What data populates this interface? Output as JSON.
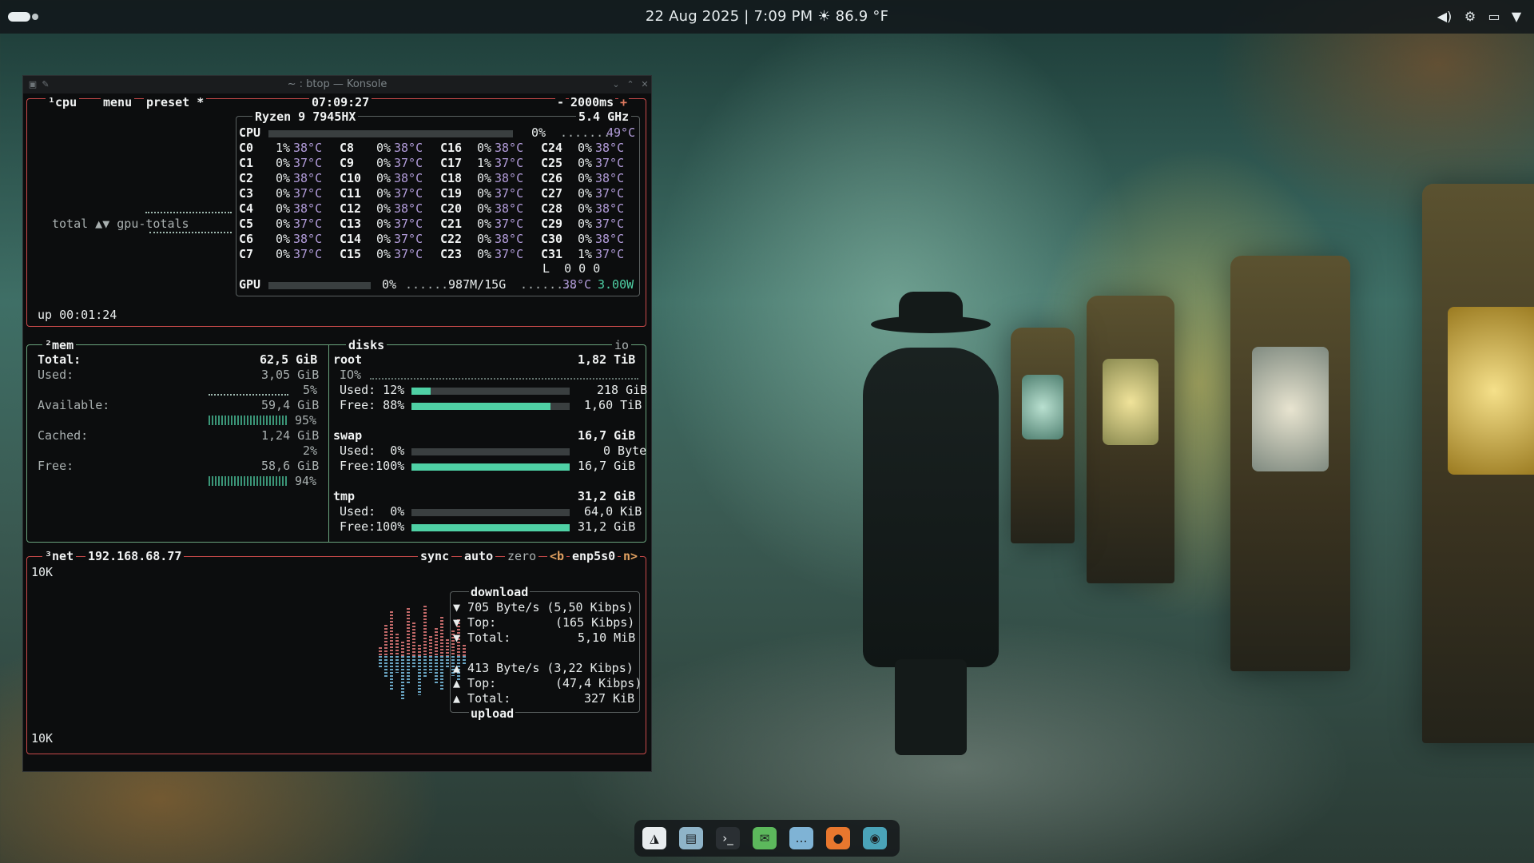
{
  "topbar": {
    "datetime": "22 Aug 2025 | 7:09 PM",
    "weather_glyph": "☀",
    "temp": "86.9 °F"
  },
  "window": {
    "title": "~ : btop — Konsole"
  },
  "cpu": {
    "tab": "¹cpu",
    "menu": "menu",
    "preset": "preset *",
    "clock": "07:09:27",
    "interval_minus": "-",
    "interval": "2000ms",
    "interval_plus": "+",
    "model": "Ryzen 9 7945HX",
    "freq": "5.4 GHz",
    "total_label": "CPU",
    "total_pct": "0%",
    "total_temp": "49°C",
    "cpu_fill": 1.0,
    "graph_label": "total ▲▼ gpu-totals",
    "uptime": "up 00:01:24",
    "load": "L  0 0 0",
    "cores": [
      [
        "C0",
        "1%",
        "38°C"
      ],
      [
        "C1",
        "0%",
        "37°C"
      ],
      [
        "C2",
        "0%",
        "38°C"
      ],
      [
        "C3",
        "0%",
        "37°C"
      ],
      [
        "C4",
        "0%",
        "38°C"
      ],
      [
        "C5",
        "0%",
        "37°C"
      ],
      [
        "C6",
        "0%",
        "38°C"
      ],
      [
        "C7",
        "0%",
        "37°C"
      ],
      [
        "C8",
        "0%",
        "38°C"
      ],
      [
        "C9",
        "0%",
        "37°C"
      ],
      [
        "C10",
        "0%",
        "38°C"
      ],
      [
        "C11",
        "0%",
        "37°C"
      ],
      [
        "C12",
        "0%",
        "38°C"
      ],
      [
        "C13",
        "0%",
        "37°C"
      ],
      [
        "C14",
        "0%",
        "37°C"
      ],
      [
        "C15",
        "0%",
        "37°C"
      ],
      [
        "C16",
        "0%",
        "38°C"
      ],
      [
        "C17",
        "1%",
        "37°C"
      ],
      [
        "C18",
        "0%",
        "38°C"
      ],
      [
        "C19",
        "0%",
        "37°C"
      ],
      [
        "C20",
        "0%",
        "38°C"
      ],
      [
        "C21",
        "0%",
        "37°C"
      ],
      [
        "C22",
        "0%",
        "38°C"
      ],
      [
        "C23",
        "0%",
        "37°C"
      ],
      [
        "C24",
        "0%",
        "38°C"
      ],
      [
        "C25",
        "0%",
        "37°C"
      ],
      [
        "C26",
        "0%",
        "38°C"
      ],
      [
        "C27",
        "0%",
        "37°C"
      ],
      [
        "C28",
        "0%",
        "38°C"
      ],
      [
        "C29",
        "0%",
        "37°C"
      ],
      [
        "C30",
        "0%",
        "38°C"
      ],
      [
        "C31",
        "1%",
        "37°C"
      ]
    ],
    "gpu": {
      "label": "GPU",
      "pct": "0%",
      "mem": "987M/15G",
      "temp": "38°C",
      "power": "3.00W"
    }
  },
  "mem": {
    "tab": "²mem",
    "total_label": "Total:",
    "total": "62,5 GiB",
    "used_label": "Used:",
    "used": "3,05 GiB",
    "used_pct": "5%",
    "avail_label": "Available:",
    "avail": "59,4 GiB",
    "avail_pct": "95%",
    "cached_label": "Cached:",
    "cached": "1,24 GiB",
    "cached_pct": "2%",
    "free_label": "Free:",
    "free": "58,6 GiB",
    "free_pct": "94%"
  },
  "disks": {
    "tab": "disks",
    "io_tab": "io",
    "root": {
      "name": "root",
      "size": "1,82 TiB",
      "io_label": "IO%",
      "used_label": "Used: 12%",
      "used": "218 GiB",
      "used_fill": 0.12,
      "free_label": "Free: 88%",
      "free": "1,60 TiB",
      "free_fill": 0.88
    },
    "swap": {
      "name": "swap",
      "size": "16,7 GiB",
      "used_label": "Used:  0%",
      "used": "0 Byte",
      "used_fill": 0.0,
      "free_label": "Free:100%",
      "free": "16,7 GiB",
      "free_fill": 1.0
    },
    "tmp": {
      "name": "tmp",
      "size": "31,2 GiB",
      "used_label": "Used:  0%",
      "used": "64,0 KiB",
      "used_fill": 0.0,
      "free_label": "Free:100%",
      "free": "31,2 GiB",
      "free_fill": 1.0
    }
  },
  "net": {
    "tab": "³net",
    "ip": "192.168.68.77",
    "sync": "sync",
    "auto": "auto",
    "zero": "zero",
    "b": "<b",
    "iface": "enp5s0",
    "n": "n>",
    "scale_top": "10K",
    "scale_bottom": "10K",
    "download_label": "download",
    "dl_rate": "▼ 705 Byte/s (5,50 Kibps)",
    "dl_top_label": "▼ Top:",
    "dl_top": "(165 Kibps)",
    "dl_total_label": "▼ Total:",
    "dl_total": "5,10 MiB",
    "ul_rate": "▲ 413 Byte/s (3,22 Kibps)",
    "ul_top_label": "▲ Top:",
    "ul_top": "(47,4 Kibps)",
    "ul_total_label": "▲ Total:",
    "ul_total": "327 KiB",
    "upload_label": "upload",
    "dl_hist": [
      0.0,
      0.15,
      0.55,
      0.8,
      0.4,
      0.25,
      0.85,
      0.6,
      0.2,
      0.9,
      0.35,
      0.5,
      0.7,
      0.3,
      0.45,
      0.65,
      0.2
    ],
    "ul_hist": [
      0.0,
      0.2,
      0.4,
      0.6,
      0.3,
      0.8,
      0.5,
      0.2,
      0.7,
      0.4,
      0.3,
      0.5,
      0.6,
      0.2,
      0.35,
      0.45,
      0.15
    ]
  },
  "dock": {
    "items": [
      "launcher-icon",
      "files-icon",
      "terminal-icon",
      "mail-icon",
      "chat-icon",
      "firefox-icon",
      "screenshot-icon"
    ]
  },
  "colors": {
    "accent": "#4fd1a5",
    "cpu_border": "#c94a4a",
    "mem_border": "#6aa37d",
    "temp": "#b39ddb"
  }
}
